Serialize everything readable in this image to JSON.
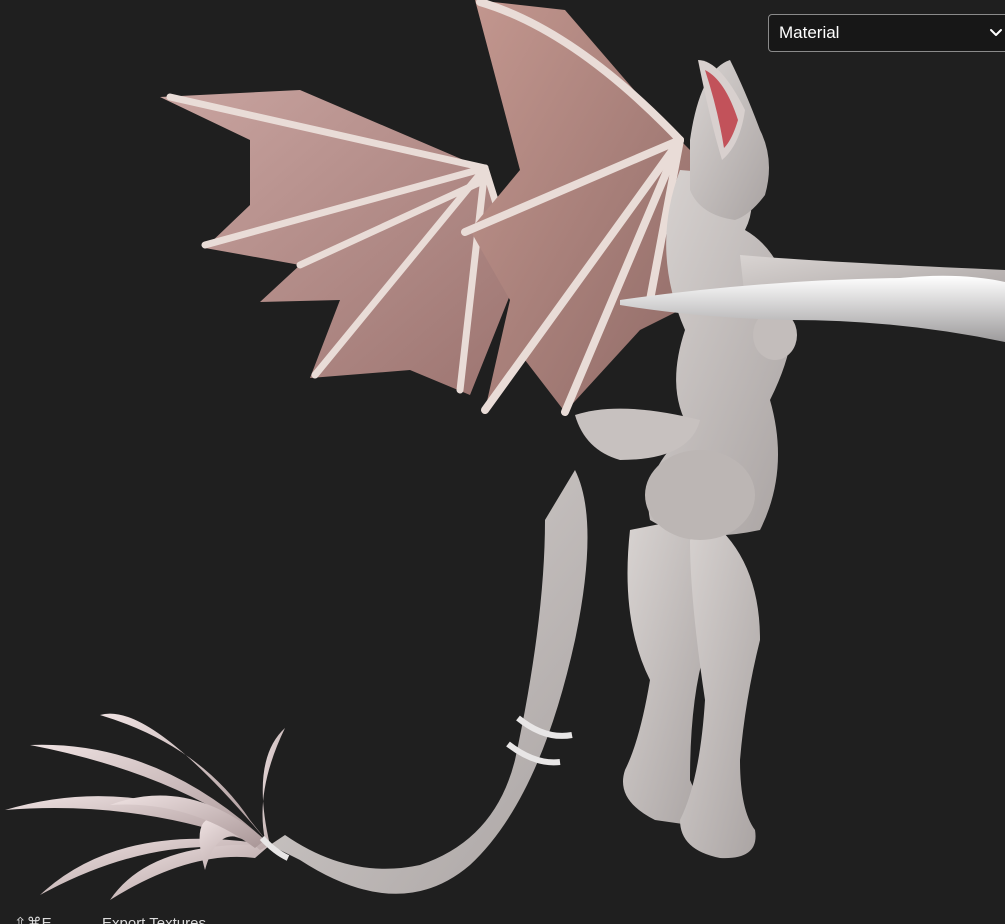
{
  "viewport": {
    "model_icon": "bat-winged-creature-3d-model"
  },
  "shading_dropdown": {
    "selected": "Material",
    "icon": "chevron-down-icon"
  },
  "bottom_bar": {
    "shortcut": "⇧⌘E",
    "export_label": "Export Textures"
  },
  "colors": {
    "background": "#1f1f1f",
    "dropdown_bg": "#171717",
    "dropdown_border": "#8a8a8a",
    "wing_membrane": "#b48b86",
    "body": "#c9c4c2"
  }
}
